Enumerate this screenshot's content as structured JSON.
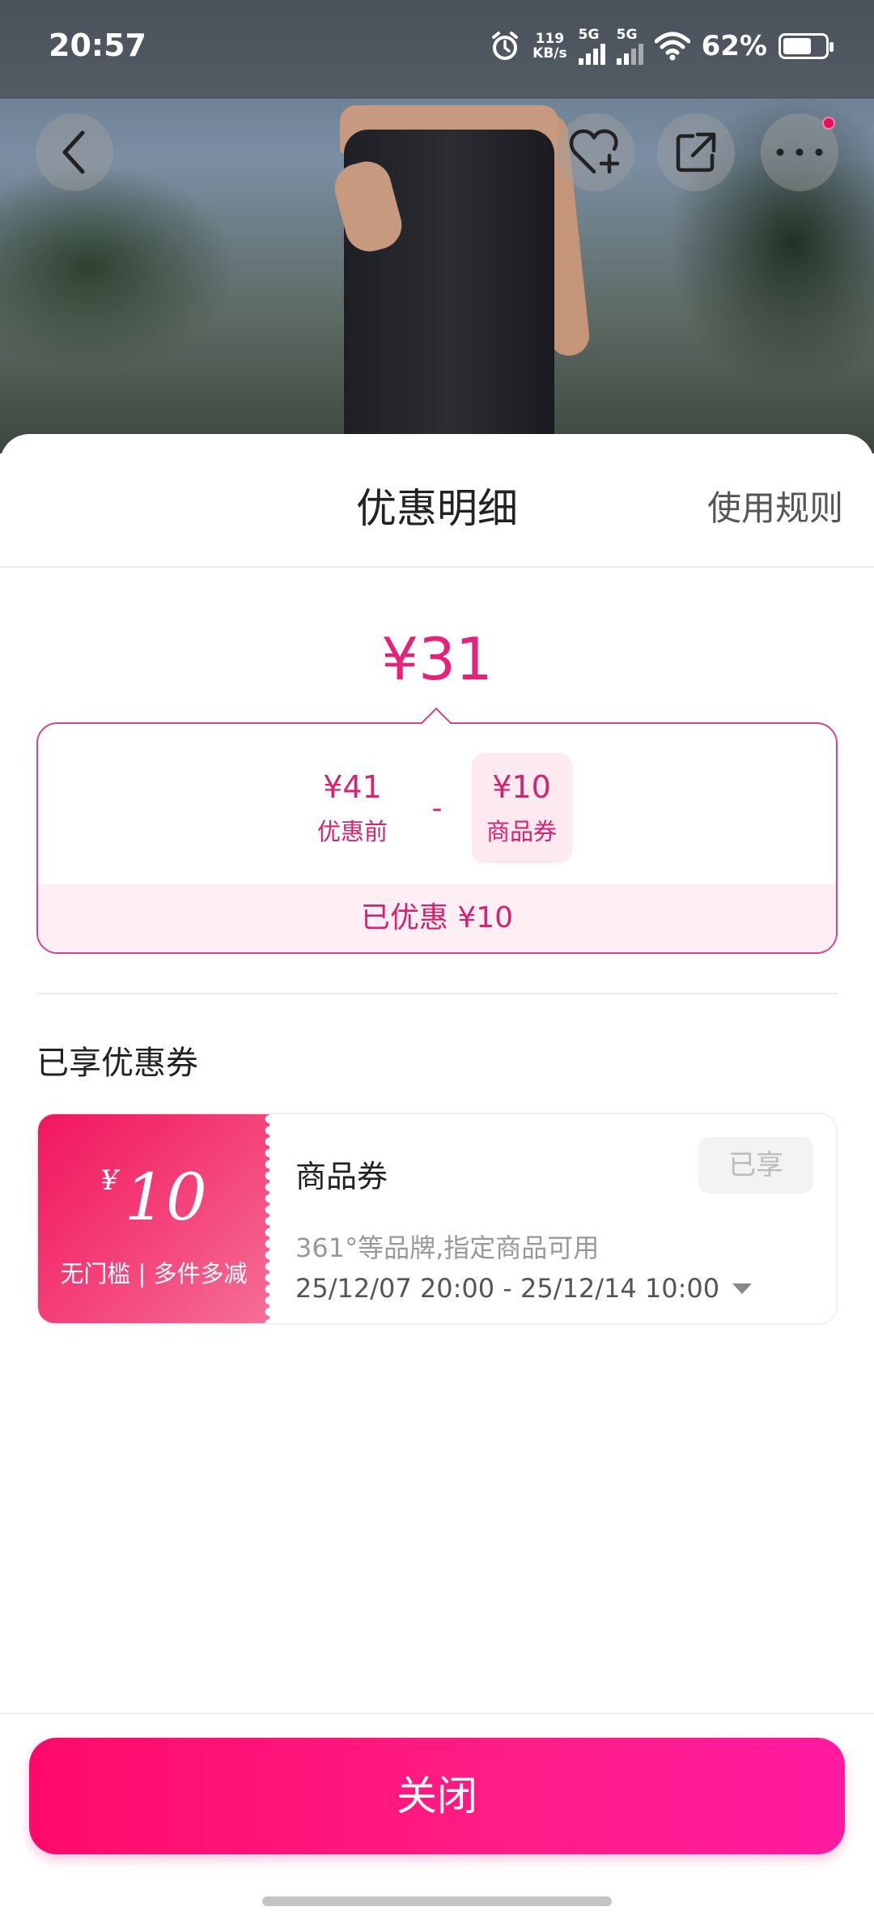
{
  "status_bar": {
    "time": "20:57",
    "net_speed_value": "119",
    "net_speed_unit": "KB/s",
    "sim1": "5G",
    "sim2": "5G",
    "battery": "62%"
  },
  "top_actions": {
    "back_icon": "chevron-left-icon",
    "favorite_icon": "heart-plus-icon",
    "share_icon": "share-icon",
    "more_icon": "more-icon"
  },
  "sheet": {
    "title": "优惠明细",
    "rules_link": "使用规则"
  },
  "price": {
    "final": "¥31",
    "original_value": "¥41",
    "original_label": "优惠前",
    "minus": "-",
    "discount_value": "¥10",
    "discount_label": "商品券",
    "saved_text": "已优惠 ¥10"
  },
  "coupons_section": {
    "title": "已享优惠券",
    "items": [
      {
        "currency": "¥",
        "amount": "10",
        "subtitle": "无门槛 | 多件多减",
        "name": "商品券",
        "desc": "361°等品牌,指定商品可用",
        "date_range": "25/12/07 20:00 - 25/12/14 10:00",
        "status": "已享"
      }
    ]
  },
  "footer": {
    "close_label": "关闭"
  },
  "colors": {
    "accent": "#e8227a",
    "button": "#ff0a6b"
  }
}
